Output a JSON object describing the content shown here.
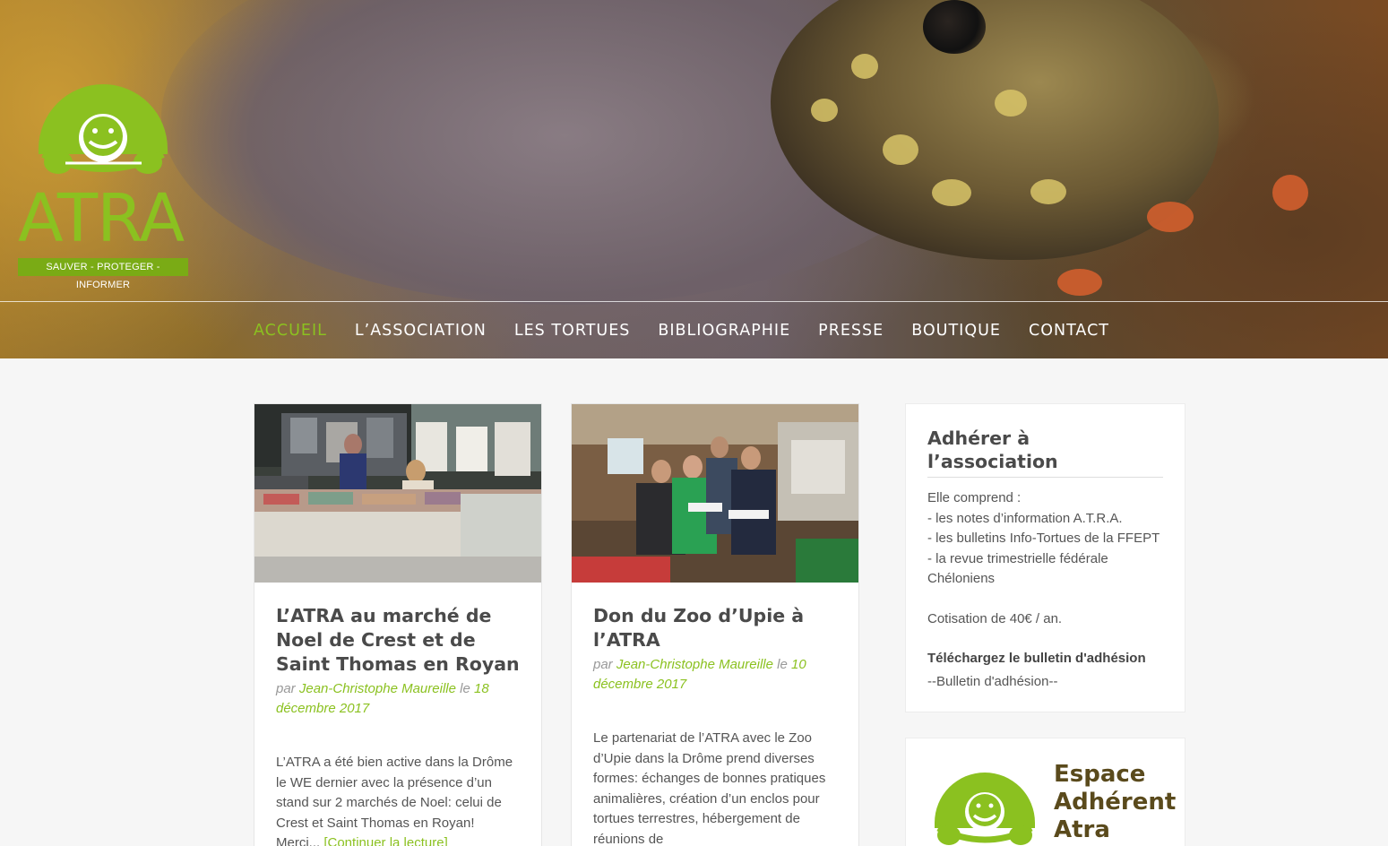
{
  "site": {
    "logo_text": "ATRA",
    "tagline": "SAUVER - PROTEGER - INFORMER"
  },
  "nav": {
    "items": [
      {
        "label": "ACCUEIL",
        "active": true
      },
      {
        "label": "L’ASSOCIATION"
      },
      {
        "label": "LES TORTUES"
      },
      {
        "label": "BIBLIOGRAPHIE"
      },
      {
        "label": "PRESSE"
      },
      {
        "label": "BOUTIQUE"
      },
      {
        "label": "CONTACT"
      }
    ]
  },
  "posts": [
    {
      "title": "L’ATRA au marché de Noel de Crest et de Saint Thomas en Royan",
      "by": "par",
      "author": "Jean-Christophe Maureille",
      "on": "le",
      "date": "18 décembre 2017",
      "excerpt": "L’ATRA a été bien active dans la Drôme le WE dernier avec la présence d’un stand sur 2 marchés de Noel: celui de Crest et Saint Thomas en Royan! Merci...",
      "more": "[Continuer la lecture]"
    },
    {
      "title": "Don du Zoo d’Upie à l’ATRA",
      "by": "par",
      "author": "Jean-Christophe Maureille",
      "on": "le",
      "date": "10 décembre 2017",
      "excerpt": "Le partenariat de l’ATRA avec le Zoo d’Upie dans la Drôme prend diverses formes: échanges de bonnes pratiques animalières, création d’un enclos pour tortues terrestres, hébergement de réunions de"
    }
  ],
  "sidebar": {
    "adherer": {
      "title": "Adhérer à l’association",
      "intro": "Elle comprend :",
      "items": [
        "- les notes d’information A.T.R.A.",
        "- les bulletins Info-Tortues de la FFEPT",
        "- la revue trimestrielle fédérale Chéloniens"
      ],
      "cotisation": "Cotisation de 40€ / an.",
      "download_title": "Téléchargez le bulletin d'adhésion",
      "download_link": "--Bulletin d'adhésion--"
    },
    "espace": {
      "line1": "Espace",
      "line2": "Adhérent",
      "line3": "Atra"
    }
  },
  "colors": {
    "accent": "#8bc120",
    "tagline_bg": "#7aab15",
    "espace_text": "#5a4a1c"
  }
}
